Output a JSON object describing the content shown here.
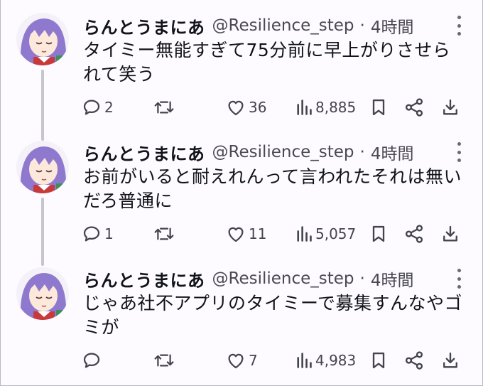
{
  "tweets": [
    {
      "name": "らんとうまにあ",
      "handle": "@Resilience_step",
      "dot": "·",
      "time": "4時間",
      "text": "タイミー無能すぎて75分前に早上がりさせられて笑う",
      "replies": "2",
      "retweets": "",
      "likes": "36",
      "views": "8,885"
    },
    {
      "name": "らんとうまにあ",
      "handle": "@Resilience_step",
      "dot": "·",
      "time": "4時間",
      "text": "お前がいると耐えれんって言われたそれは無いだろ普通に",
      "replies": "1",
      "retweets": "",
      "likes": "11",
      "views": "5,057"
    },
    {
      "name": "らんとうまにあ",
      "handle": "@Resilience_step",
      "dot": "·",
      "time": "4時間",
      "text": "じゃあ社不アプリのタイミーで募集すんなやゴミが",
      "replies": "",
      "retweets": "",
      "likes": "7",
      "views": "4,983"
    }
  ],
  "icons": {
    "reply": "reply-icon",
    "retweet": "retweet-icon",
    "like": "heart-icon",
    "views": "views-icon",
    "bookmark": "bookmark-icon",
    "share": "share-icon",
    "download": "download-icon",
    "more": "more-vertical-icon"
  },
  "colors": {
    "text": "#111318",
    "meta": "#4a4a52",
    "icon": "#44444c",
    "thread_line": "#c7c5cc",
    "avatar_hair": "#8f79cf"
  }
}
